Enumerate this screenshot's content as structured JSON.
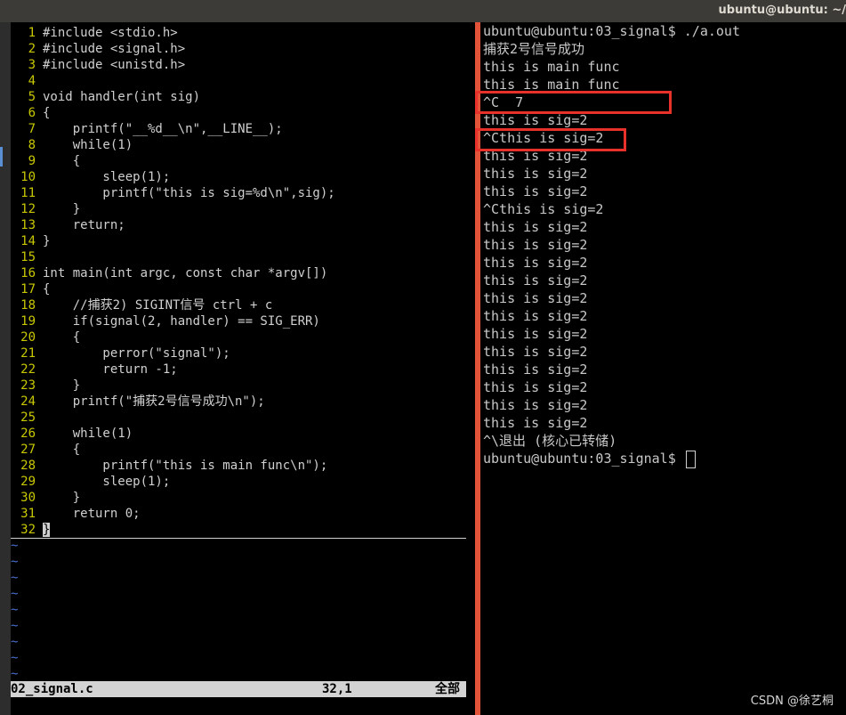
{
  "window": {
    "title": "ubuntu@ubuntu: ~/"
  },
  "editor": {
    "lines": [
      {
        "num": "1",
        "text": "#include <stdio.h>"
      },
      {
        "num": "2",
        "text": "#include <signal.h>"
      },
      {
        "num": "3",
        "text": "#include <unistd.h>"
      },
      {
        "num": "4",
        "text": ""
      },
      {
        "num": "5",
        "text": "void handler(int sig)"
      },
      {
        "num": "6",
        "text": "{"
      },
      {
        "num": "7",
        "text": "    printf(\"__%d__\\n\",__LINE__);"
      },
      {
        "num": "8",
        "text": "    while(1)"
      },
      {
        "num": "9",
        "text": "    {"
      },
      {
        "num": "10",
        "text": "        sleep(1);"
      },
      {
        "num": "11",
        "text": "        printf(\"this is sig=%d\\n\",sig);"
      },
      {
        "num": "12",
        "text": "    }"
      },
      {
        "num": "13",
        "text": "    return;"
      },
      {
        "num": "14",
        "text": "}"
      },
      {
        "num": "15",
        "text": ""
      },
      {
        "num": "16",
        "text": "int main(int argc, const char *argv[])"
      },
      {
        "num": "17",
        "text": "{"
      },
      {
        "num": "18",
        "text": "    //捕获2) SIGINT信号 ctrl + c"
      },
      {
        "num": "19",
        "text": "    if(signal(2, handler) == SIG_ERR)"
      },
      {
        "num": "20",
        "text": "    {"
      },
      {
        "num": "21",
        "text": "        perror(\"signal\");"
      },
      {
        "num": "22",
        "text": "        return -1;"
      },
      {
        "num": "23",
        "text": "    }"
      },
      {
        "num": "24",
        "text": "    printf(\"捕获2号信号成功\\n\");"
      },
      {
        "num": "25",
        "text": ""
      },
      {
        "num": "26",
        "text": "    while(1)"
      },
      {
        "num": "27",
        "text": "    {"
      },
      {
        "num": "28",
        "text": "        printf(\"this is main func\\n\");"
      },
      {
        "num": "29",
        "text": "        sleep(1);"
      },
      {
        "num": "30",
        "text": "    }"
      },
      {
        "num": "31",
        "text": "    return 0;"
      },
      {
        "num": "32",
        "text": "}"
      }
    ],
    "tildes": [
      "~",
      "~",
      "~",
      "~",
      "~",
      "~",
      "~",
      "~",
      "~"
    ],
    "status": {
      "filename": "02_signal.c",
      "position": "32,1",
      "scope": "全部"
    }
  },
  "terminal": {
    "lines": [
      "ubuntu@ubuntu:03_signal$ ./a.out",
      "捕获2号信号成功",
      "this is main func",
      "this is main func",
      "^C  7",
      "this is sig=2",
      "^Cthis is sig=2",
      "this is sig=2",
      "this is sig=2",
      "this is sig=2",
      "^Cthis is sig=2",
      "this is sig=2",
      "this is sig=2",
      "this is sig=2",
      "this is sig=2",
      "this is sig=2",
      "this is sig=2",
      "this is sig=2",
      "this is sig=2",
      "this is sig=2",
      "this is sig=2",
      "this is sig=2",
      "this is sig=2",
      "^\\退出 (核心已转储)"
    ],
    "prompt": "ubuntu@ubuntu:03_signal$"
  },
  "watermark": "CSDN @徐艺桐"
}
